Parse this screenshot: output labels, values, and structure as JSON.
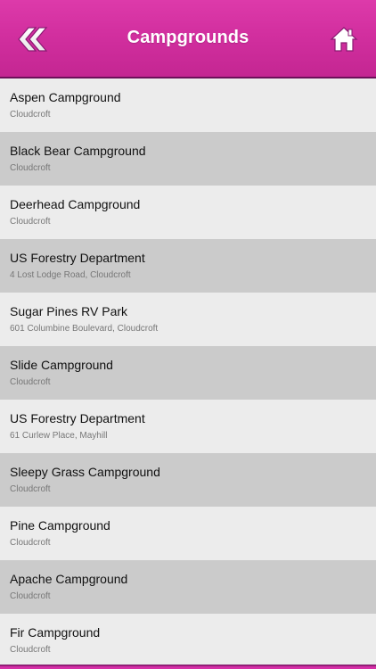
{
  "header": {
    "title": "Campgrounds",
    "back_icon": "double-chevron-left-icon",
    "home_icon": "home-icon"
  },
  "colors": {
    "header_bg": "#d22f9f",
    "header_border": "#6c1059",
    "row_light": "#ececec",
    "row_dark": "#cbcbcb"
  },
  "list": {
    "items": [
      {
        "title": "Aspen Campground",
        "subtitle": "Cloudcroft"
      },
      {
        "title": "Black Bear Campground",
        "subtitle": "Cloudcroft"
      },
      {
        "title": "Deerhead Campground",
        "subtitle": "Cloudcroft"
      },
      {
        "title": "US Forestry Department",
        "subtitle": "4 Lost Lodge Road, Cloudcroft"
      },
      {
        "title": "Sugar Pines RV Park",
        "subtitle": "601 Columbine Boulevard, Cloudcroft"
      },
      {
        "title": "Slide Campground",
        "subtitle": "Cloudcroft"
      },
      {
        "title": "US Forestry Department",
        "subtitle": "61 Curlew Place, Mayhill"
      },
      {
        "title": "Sleepy Grass Campground",
        "subtitle": "Cloudcroft"
      },
      {
        "title": "Pine Campground",
        "subtitle": "Cloudcroft"
      },
      {
        "title": "Apache Campground",
        "subtitle": "Cloudcroft"
      },
      {
        "title": "Fir Campground",
        "subtitle": "Cloudcroft"
      }
    ]
  }
}
